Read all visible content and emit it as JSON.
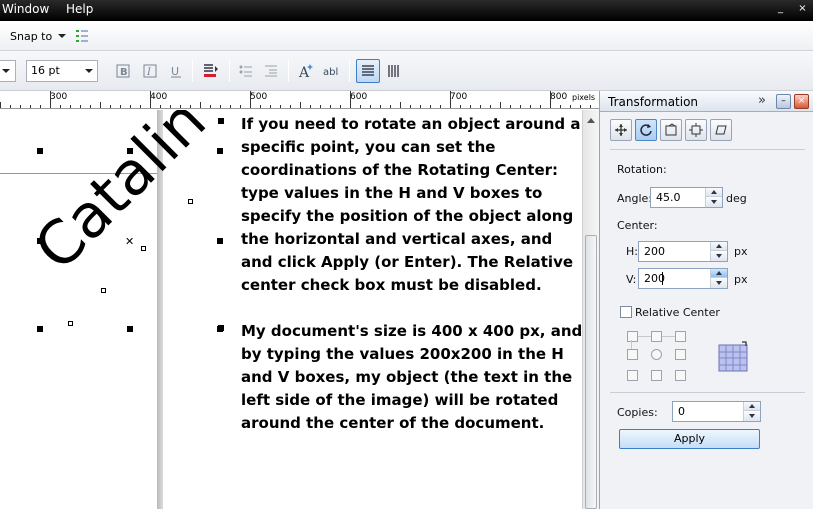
{
  "menubar": {
    "items": [
      "Window",
      "Help"
    ]
  },
  "toolbar1": {
    "snap_label": "Snap to"
  },
  "toolbar2": {
    "font_size": "16 pt"
  },
  "ruler": {
    "labels": [
      "300",
      "400",
      "500",
      "600",
      "700",
      "800"
    ],
    "unit": "pixels"
  },
  "canvas": {
    "rotated_text": "Catalin",
    "paragraph1": [
      "If you need to rotate an object around a",
      "specific point, you can set the",
      "coordinations of the Rotating Center:",
      "type values in the H and V boxes to",
      "specify the position of the object along",
      "the horizontal and vertical axes, and",
      "and click Apply (or Enter). The Relative",
      "center check box must be disabled."
    ],
    "paragraph2": [
      "My document's size is 400 x 400 px, and",
      "by typing the values 200x200 in the H",
      "and V boxes, my object (the text in the",
      "left side of the image) will be rotated",
      "around the center of the document."
    ]
  },
  "docker": {
    "title": "Transformation",
    "rotation_label": "Rotation:",
    "angle_label": "Angle:",
    "angle_value": "45.0",
    "angle_unit": "deg",
    "center_label": "Center:",
    "h_label": "H:",
    "h_value": "200",
    "h_unit": "px",
    "v_label": "V:",
    "v_value": "200",
    "v_unit": "px",
    "relative_center_label": "Relative Center",
    "relative_center_checked": false,
    "copies_label": "Copies:",
    "copies_value": "0",
    "apply_label": "Apply"
  },
  "colors": {
    "accent": "#3c7fc8",
    "menubar": "#000000",
    "active_tab": "#a9cdf4"
  }
}
